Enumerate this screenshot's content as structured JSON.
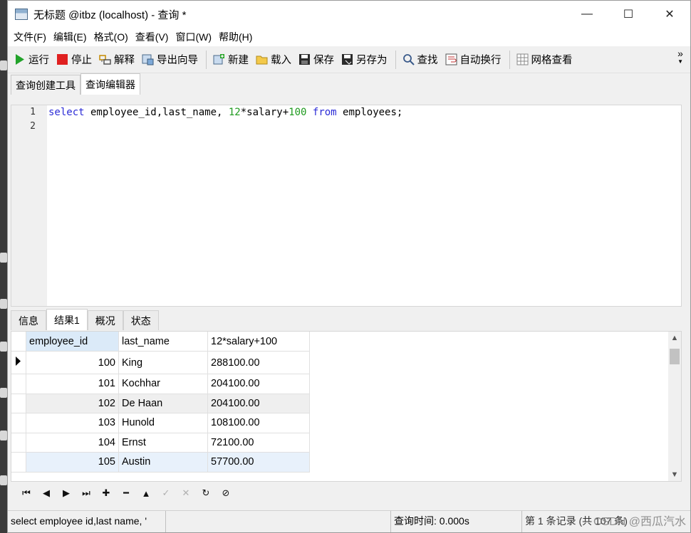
{
  "window": {
    "title": "无标题 @itbz (localhost) - 查询 *",
    "minimize": "—",
    "maximize": "☐",
    "close": "✕"
  },
  "menu": [
    "文件(F)",
    "编辑(E)",
    "格式(O)",
    "查看(V)",
    "窗口(W)",
    "帮助(H)"
  ],
  "toolbar": {
    "run": "运行",
    "stop": "停止",
    "explain": "解释",
    "export_wizard": "导出向导",
    "new": "新建",
    "load": "载入",
    "save": "保存",
    "save_as": "另存为",
    "find": "查找",
    "word_wrap": "自动换行",
    "grid_view": "网格查看",
    "more": "»"
  },
  "editor_tabs": [
    "查询创建工具",
    "查询编辑器"
  ],
  "editor": {
    "line_numbers": [
      "1",
      "2"
    ],
    "sql_keyword_select": "select",
    "sql_cols": " employee_id,last_name, ",
    "sql_num_12": "12",
    "sql_mid": "*salary+",
    "sql_num_100": "100",
    "sql_keyword_from": " from",
    "sql_tail": " employees;"
  },
  "result_tabs": [
    "信息",
    "结果1",
    "概况",
    "状态"
  ],
  "grid": {
    "columns": [
      "employee_id",
      "last_name",
      "12*salary+100"
    ],
    "rows": [
      [
        "100",
        "King",
        "288100.00"
      ],
      [
        "101",
        "Kochhar",
        "204100.00"
      ],
      [
        "102",
        "De Haan",
        "204100.00"
      ],
      [
        "103",
        "Hunold",
        "108100.00"
      ],
      [
        "104",
        "Ernst",
        "72100.00"
      ],
      [
        "105",
        "Austin",
        "57700.00"
      ]
    ]
  },
  "status": {
    "sql": "select employee id,last name, '",
    "query_time": "查询时间: 0.000s",
    "record": "第 1 条记录 (共 107 条)",
    "watermark": "CSDN @西瓜汽水"
  },
  "colors": {
    "keyword": "#2b2bd6",
    "number": "#1e9a1e",
    "selected_header": "#dbeaf8"
  }
}
